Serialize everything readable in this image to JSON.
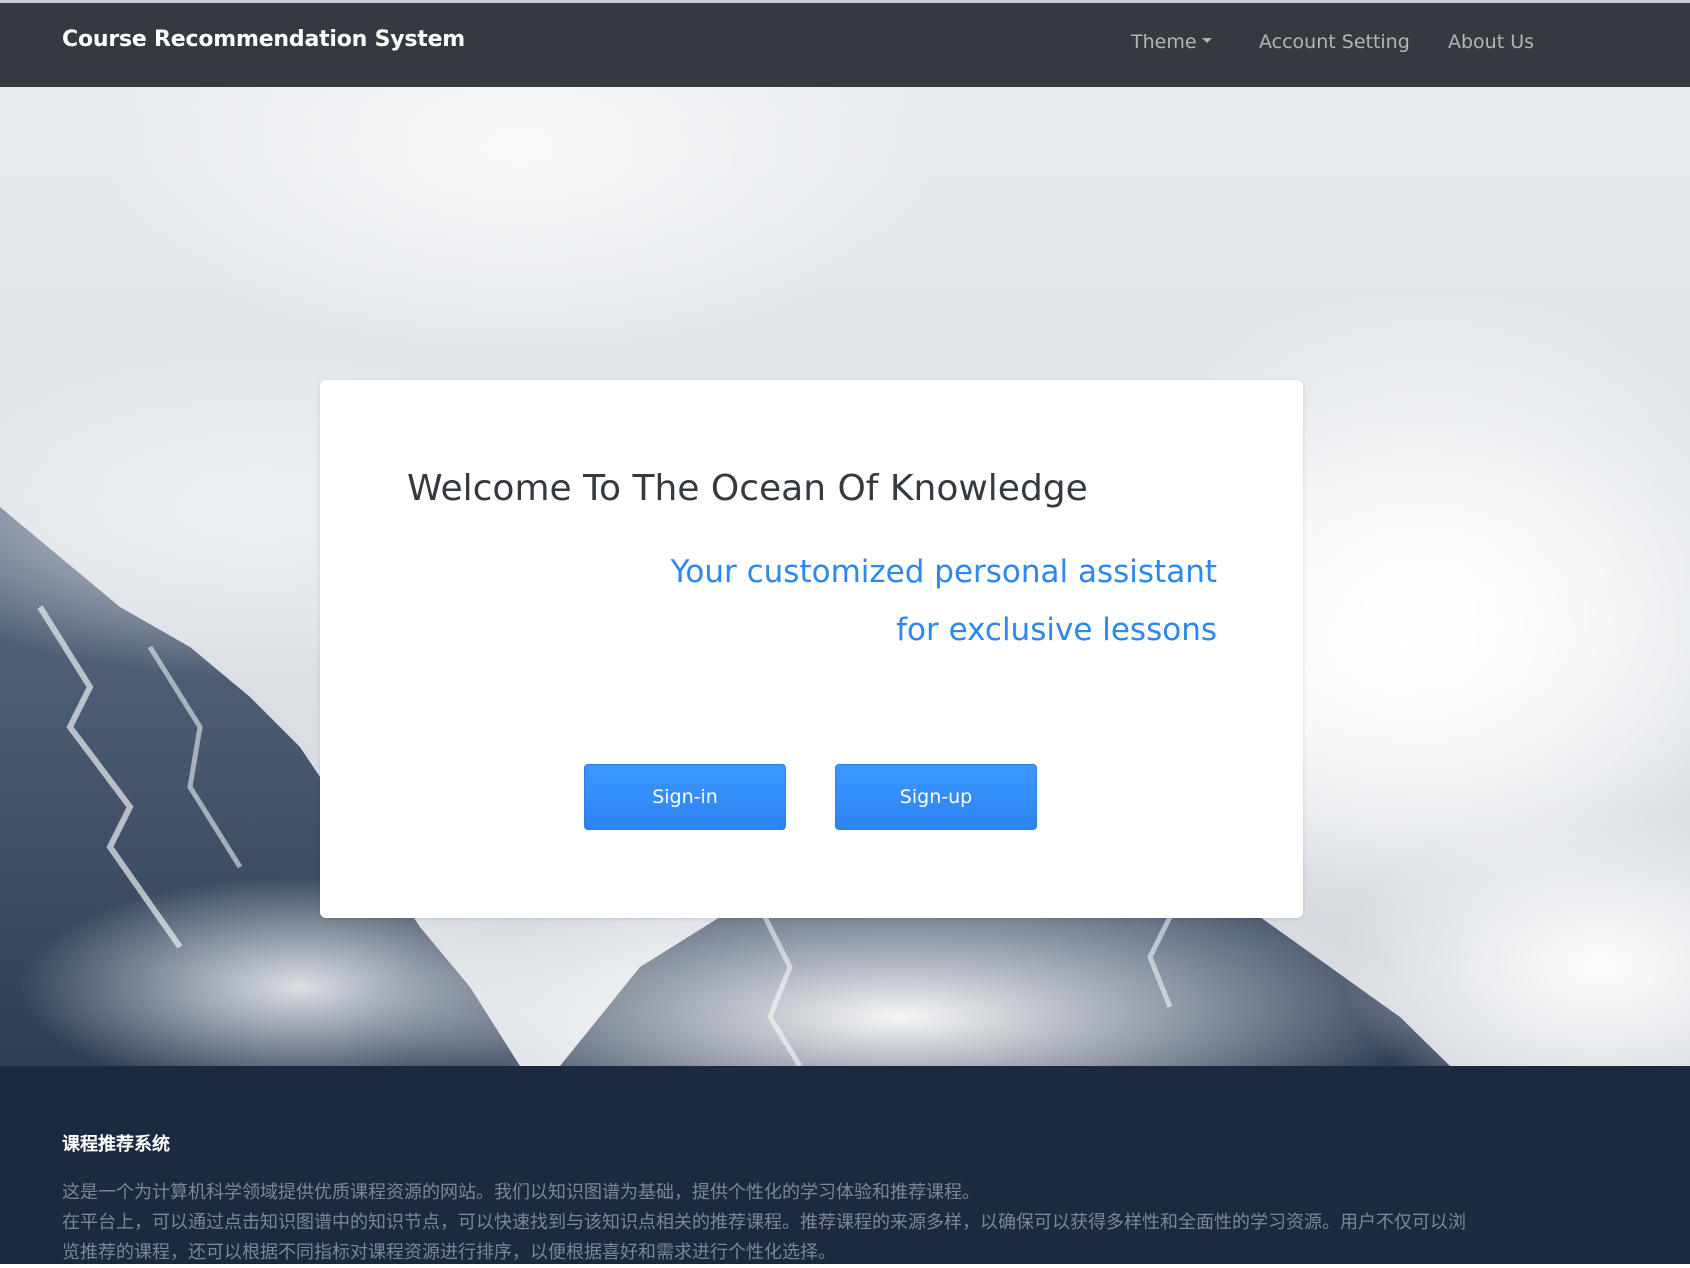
{
  "navbar": {
    "brand": "Course Recommendation System",
    "items": [
      {
        "label": "Theme"
      },
      {
        "label": "Account Setting"
      },
      {
        "label": "About Us"
      }
    ]
  },
  "card": {
    "title": "Welcome To The Ocean Of Knowledge",
    "subtitle": "Your customized personal assistant for exclusive lessons",
    "signin_label": "Sign-in",
    "signup_label": "Sign-up"
  },
  "footer": {
    "title": "课程推荐系统",
    "lines": [
      "这是一个为计算机科学领域提供优质课程资源的网站。我们以知识图谱为基础，提供个性化的学习体验和推荐课程。",
      "在平台上，可以通过点击知识图谱中的知识节点，可以快速找到与该知识点相关的推荐课程。推荐课程的来源多样，以确保可以获得多样性和全面性的学习资源。用户不仅可以浏览推荐的课程，还可以根据不同指标对课程资源进行排序，以便根据喜好和需求进行个性化选择。"
    ]
  },
  "colors": {
    "navbar_bg": "#343a40",
    "accent": "#2d87f0",
    "footer_bg": "#1c2a40"
  }
}
